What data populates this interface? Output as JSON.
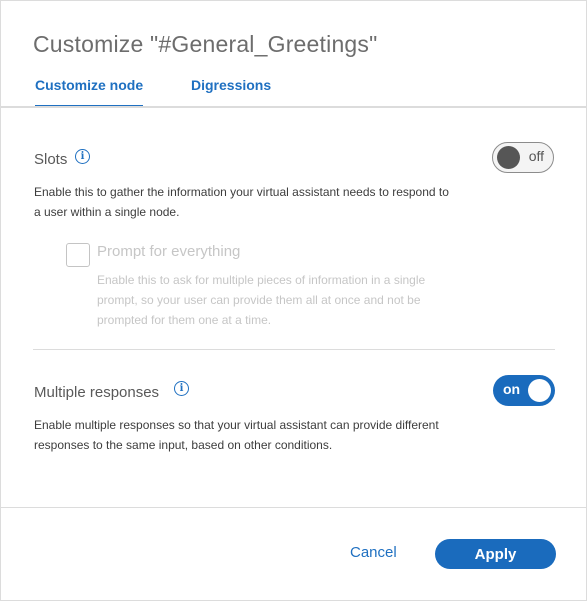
{
  "dialog": {
    "title": "Customize \"#General_Greetings\""
  },
  "tabs": [
    {
      "label": "Customize node",
      "active": true
    },
    {
      "label": "Digressions",
      "active": false
    }
  ],
  "slots": {
    "label": "Slots",
    "info_icon": "info-icon",
    "toggle_state": "off",
    "description_line1": "Enable this to gather the information your virtual assistant needs to respond to",
    "description_line2": "a user within a single node.",
    "prompt_checkbox": {
      "label": "Prompt for everything",
      "checked": false,
      "disabled": true,
      "description_line1": "Enable this to ask for multiple pieces of information in a single",
      "description_line2": "prompt, so your user can provide them all at once and not be",
      "description_line3": "prompted for them one at a time."
    }
  },
  "multiple_responses": {
    "label": "Multiple responses",
    "info_icon": "info-icon",
    "toggle_state": "on",
    "description_line1": "Enable multiple responses so that your virtual assistant can provide different",
    "description_line2": "responses to the same input, based on other conditions."
  },
  "footer": {
    "cancel_label": "Cancel",
    "apply_label": "Apply"
  },
  "colors": {
    "accent": "#1f70c1",
    "primary_button": "#1a6bbd",
    "disabled_text": "#c6c6c6"
  }
}
